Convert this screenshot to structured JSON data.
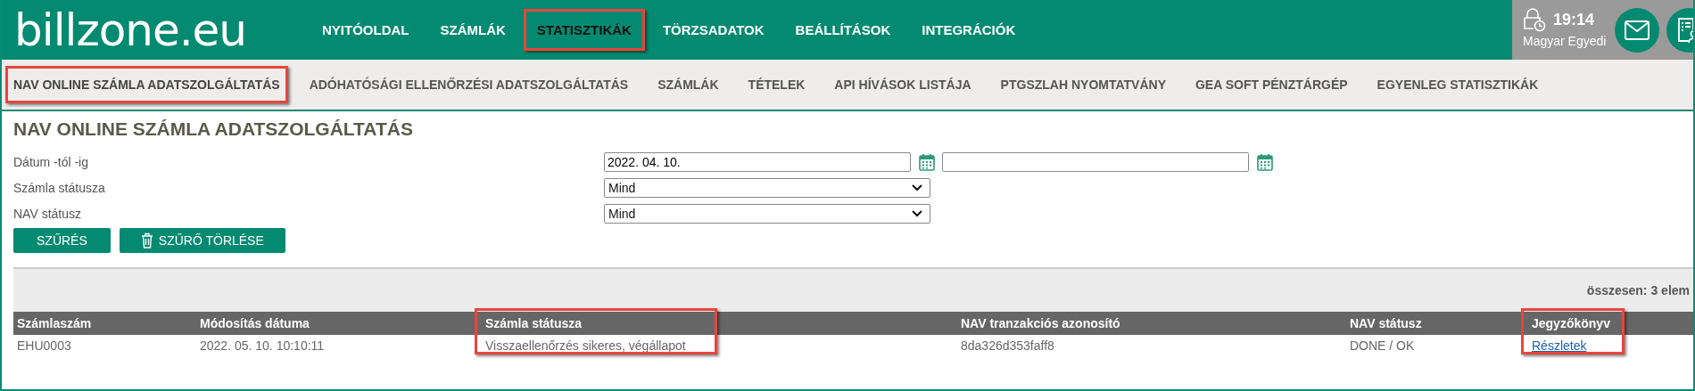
{
  "logo": "billzone.eu",
  "nav": [
    {
      "label": "NYITÓOLDAL",
      "selected": false
    },
    {
      "label": "SZÁMLÁK",
      "selected": false
    },
    {
      "label": "STATISZTIKÁK",
      "selected": true
    },
    {
      "label": "TÖRZSADATOK",
      "selected": false
    },
    {
      "label": "BEÁLLÍTÁSOK",
      "selected": false
    },
    {
      "label": "INTEGRÁCIÓK",
      "selected": false
    }
  ],
  "session": {
    "time": "19:14",
    "user": "Magyar Egyedi"
  },
  "subnav": [
    {
      "label": "NAV ONLINE SZÁMLA ADATSZOLGÁLTATÁS",
      "selected": true
    },
    {
      "label": "ADÓHATÓSÁGI ELLENŐRZÉSI ADATSZOLGÁLTATÁS",
      "selected": false
    },
    {
      "label": "SZÁMLÁK",
      "selected": false
    },
    {
      "label": "TÉTELEK",
      "selected": false
    },
    {
      "label": "API HÍVÁSOK LISTÁJA",
      "selected": false
    },
    {
      "label": "PTGSZLAH NYOMTATVÁNY",
      "selected": false
    },
    {
      "label": "GEA SOFT PÉNZTÁRGÉP",
      "selected": false
    },
    {
      "label": "EGYENLEG STATISZTIKÁK",
      "selected": false
    }
  ],
  "page_title": "NAV ONLINE SZÁMLA ADATSZOLGÁLTATÁS",
  "filters": [
    {
      "label": "Dátum -tól -ig",
      "kind": "daterange",
      "from": "2022. 04. 10."
    },
    {
      "label": "Számla státusza",
      "kind": "select",
      "value": "Mind"
    },
    {
      "label": "NAV státusz",
      "kind": "select",
      "value": "Mind"
    }
  ],
  "buttons": [
    {
      "label": "SZŰRÉS",
      "kind": "plain"
    },
    {
      "label": "SZŰRŐ TÖRLÉSE",
      "kind": "trash"
    }
  ],
  "table": {
    "total": "összesen: 3 elem",
    "columns": [
      {
        "label": "Számlaszám",
        "highlighted": false
      },
      {
        "label": "Módosítás dátuma",
        "highlighted": false
      },
      {
        "label": "Számla státusza",
        "highlighted": true
      },
      {
        "label": "NAV tranzakciós azonosító",
        "highlighted": false
      },
      {
        "label": "NAV státusz",
        "highlighted": false
      },
      {
        "label": "Jegyzőkönyv",
        "highlighted": true
      }
    ],
    "rows": [
      [
        "EHU0003",
        "2022. 05. 10. 10:10:11",
        "Visszaellenőrzés sikeres, végállapot",
        "8da326d353faff8",
        "DONE / OK",
        "Részletek"
      ]
    ]
  }
}
